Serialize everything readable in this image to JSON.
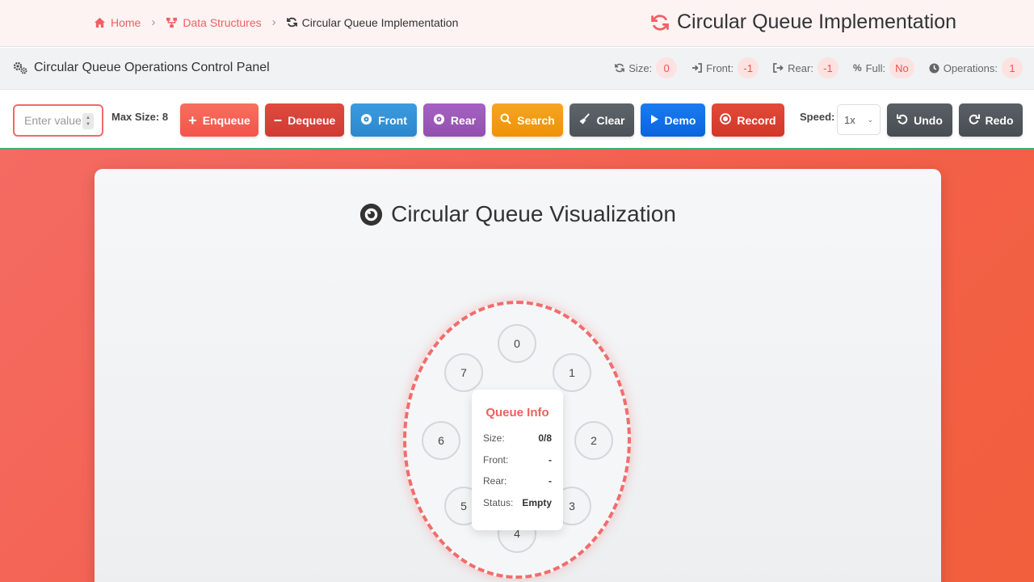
{
  "breadcrumb": {
    "home": "Home",
    "section": "Data Structures",
    "current": "Circular Queue Implementation"
  },
  "app_title": "Circular Queue Implementation",
  "panel": {
    "title": "Circular Queue Operations Control Panel",
    "stats": [
      {
        "label": "Size:",
        "value": "0",
        "icon": "refresh-icon"
      },
      {
        "label": "Front:",
        "value": "-1",
        "icon": "sign-in-icon"
      },
      {
        "label": "Rear:",
        "value": "-1",
        "icon": "sign-out-icon"
      },
      {
        "label": "Full:",
        "value": "No",
        "icon": "percent-icon"
      },
      {
        "label": "Operations:",
        "value": "1",
        "icon": "clock-icon"
      }
    ]
  },
  "toolbar": {
    "input_placeholder": "Enter value",
    "max_size": "Max Size: 8",
    "buttons": {
      "enqueue": "Enqueue",
      "dequeue": "Dequeue",
      "front": "Front",
      "rear": "Rear",
      "search": "Search",
      "clear": "Clear",
      "demo": "Demo",
      "record": "Record",
      "undo": "Undo",
      "redo": "Redo"
    },
    "speed_label": "Speed:",
    "speed_value": "1x"
  },
  "colors": {
    "accent": "#f06060",
    "enqueue": "#f5604f",
    "dequeue": "#d9453b",
    "front": "#3493d6",
    "rear": "#9b59b6",
    "search": "#f39c12",
    "clear": "#555b61",
    "demo": "#0f6ee8",
    "record": "#dc3d2d",
    "undo": "#50565c",
    "redo": "#50565c"
  },
  "viz": {
    "title": "Circular Queue Visualization",
    "slots": [
      "0",
      "1",
      "2",
      "3",
      "4",
      "5",
      "6",
      "7"
    ],
    "info": {
      "title": "Queue Info",
      "rows": [
        {
          "label": "Size:",
          "value": "0/8"
        },
        {
          "label": "Front:",
          "value": "-"
        },
        {
          "label": "Rear:",
          "value": "-"
        },
        {
          "label": "Status:",
          "value": "Empty"
        }
      ]
    }
  }
}
